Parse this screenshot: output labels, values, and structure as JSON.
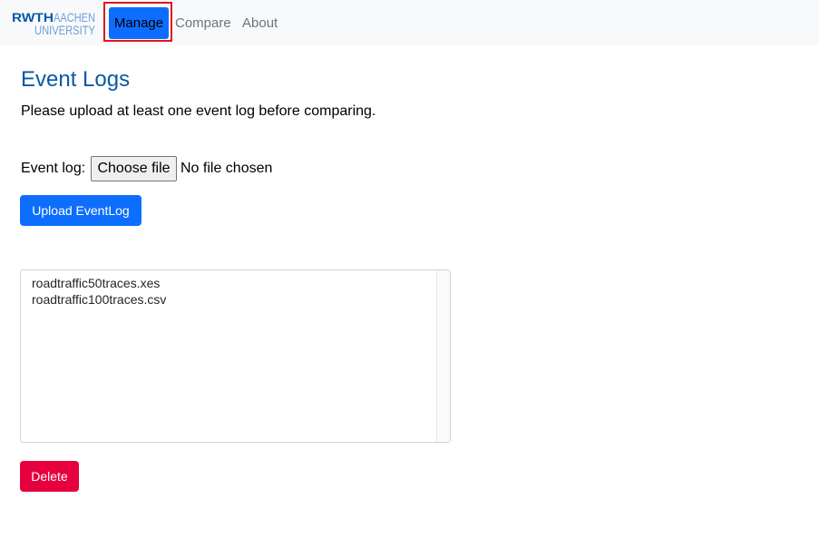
{
  "navbar": {
    "logo": {
      "line1_bold": "RWTH",
      "line1_light": "AACHEN",
      "line2": "UNIVERSITY",
      "color": "#0b57a8"
    },
    "items": [
      {
        "label": "Manage",
        "active": true
      },
      {
        "label": "Compare",
        "active": false
      },
      {
        "label": "About",
        "active": false
      }
    ]
  },
  "main": {
    "title": "Event Logs",
    "info": "Please upload at least one event log before comparing.",
    "file_input": {
      "label": "Event log:",
      "button": "Choose file",
      "status": "No file chosen"
    },
    "upload_button": "Upload EventLog",
    "event_logs": [
      "roadtraffic50traces.xes",
      "roadtraffic100traces.csv"
    ],
    "delete_button": "Delete"
  },
  "colors": {
    "primary": "#0d6efd",
    "danger": "#e6003d",
    "title": "#0b57a8",
    "highlight": "#e0191b"
  }
}
